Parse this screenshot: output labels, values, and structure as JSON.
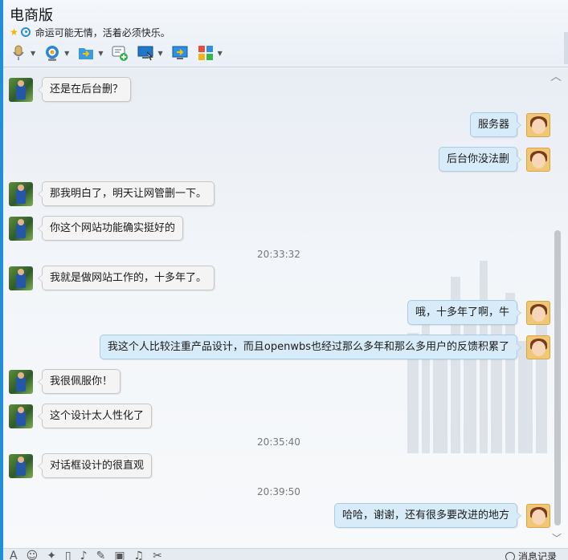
{
  "window": {
    "title": "电商版",
    "signature": "命运可能无情，活着必须快乐。"
  },
  "toolbar": {
    "items": [
      {
        "icon": "microphone-icon",
        "has_menu": true
      },
      {
        "icon": "webcam-icon",
        "has_menu": true
      },
      {
        "icon": "file-transfer-icon",
        "has_menu": true
      },
      {
        "icon": "add-chat-icon",
        "has_menu": false
      },
      {
        "icon": "remote-desktop-icon",
        "has_menu": true
      },
      {
        "icon": "screen-share-icon",
        "has_menu": false
      },
      {
        "icon": "app-grid-icon",
        "has_menu": true
      }
    ]
  },
  "chat": {
    "messages": [
      {
        "side": "in",
        "text": "还是在后台删？"
      },
      {
        "side": "out",
        "text": "服务器"
      },
      {
        "side": "out",
        "text": "后台你没法删"
      },
      {
        "side": "in",
        "text": "那我明白了，明天让网管删一下。"
      },
      {
        "side": "in",
        "text": "你这个网站功能确实挺好的"
      },
      {
        "side": "time",
        "text": "20:33:32"
      },
      {
        "side": "in",
        "text": "我就是做网站工作的，十多年了。"
      },
      {
        "side": "out",
        "text": "哦，十多年了啊，牛"
      },
      {
        "side": "out",
        "text": "我这个人比较注重产品设计，而且openwbs也经过那么多年和那么多用户的反馈积累了"
      },
      {
        "side": "in",
        "text": "我很佩服你！"
      },
      {
        "side": "in",
        "text": "这个设计太人性化了"
      },
      {
        "side": "time",
        "text": "20:35:40"
      },
      {
        "side": "in",
        "text": "对话框设计的很直观"
      },
      {
        "side": "time",
        "text": "20:39:50"
      },
      {
        "side": "out",
        "text": "哈哈，谢谢，还有很多要改进的地方"
      }
    ]
  },
  "bottom": {
    "history_label": "消息记录"
  },
  "colors": {
    "accent": "#1f8fd8",
    "incoming_bubble": "#f4f4f4",
    "outgoing_bubble": "#d7ebf8"
  }
}
